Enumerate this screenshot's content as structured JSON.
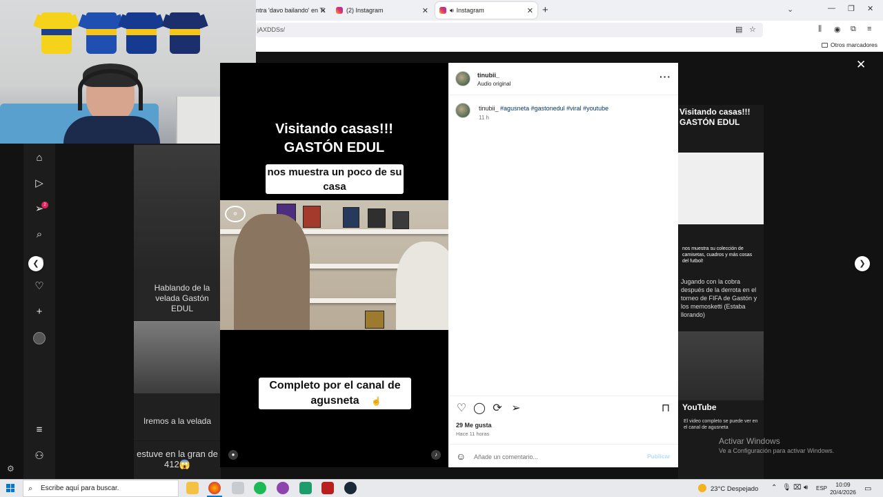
{
  "browser": {
    "tabs": [
      {
        "label": "ntra 'davo bailando' en Ti",
        "close": "✕"
      },
      {
        "label": "(2) Instagram",
        "close": "✕"
      },
      {
        "label": "Instagram",
        "close": "✕",
        "active": true
      }
    ],
    "new_tab": "+",
    "url": "jAXDDSs/",
    "bookmarks_label": "Otros marcadores"
  },
  "reel": {
    "title_line1": "Visitando casas!!!",
    "title_line2": "GASTÓN EDUL",
    "subtitle": "nos muestra un poco de su casa",
    "bottom_caption": "Completo por el canal de agusneta"
  },
  "post": {
    "username": "tinubii_",
    "audio": "Audio original",
    "more": "···",
    "caption_user": "tinubii_",
    "caption_tags": "#agusneta #gastonedul #viral #youtube",
    "caption_time": "11 h",
    "likes": "29 Me gusta",
    "posted_ago": "Hace 11 horas",
    "comment_placeholder": "Añade un comentario...",
    "publish": "Publicar"
  },
  "background_feed": {
    "left_text1": "Hablando de la velada Gastón EDUL",
    "left_text2": "Iremos a la velada",
    "left_text3": "estuve en la gran de 412😱",
    "right_text1": "Visitando casas!!! GASTÓN EDUL",
    "right_text2": "nos muestra su colección de camisetas, cuadros y más cosas del futbol!",
    "right_text3": "Jugando con la cobra después de la derrota en el torneo de FIFA de Gastón y los memosketti (Estaba llorando)",
    "right_text4": "YouTube",
    "right_text5": "El video completo se puede ver en el canal de agusneta"
  },
  "sidebar": {
    "notifications_count": "2"
  },
  "watermark": {
    "line1": "Activar Windows",
    "line2": "Ve a Configuración para activar Windows."
  },
  "taskbar": {
    "search_placeholder": "Escribe aquí para buscar.",
    "weather": "23°C  Despejado",
    "language": "ESP",
    "time": "10:09",
    "date": "20/4/2026"
  },
  "colors": {
    "accent": "#0095f6",
    "link": "#00376b",
    "badge": "#e0245e"
  }
}
